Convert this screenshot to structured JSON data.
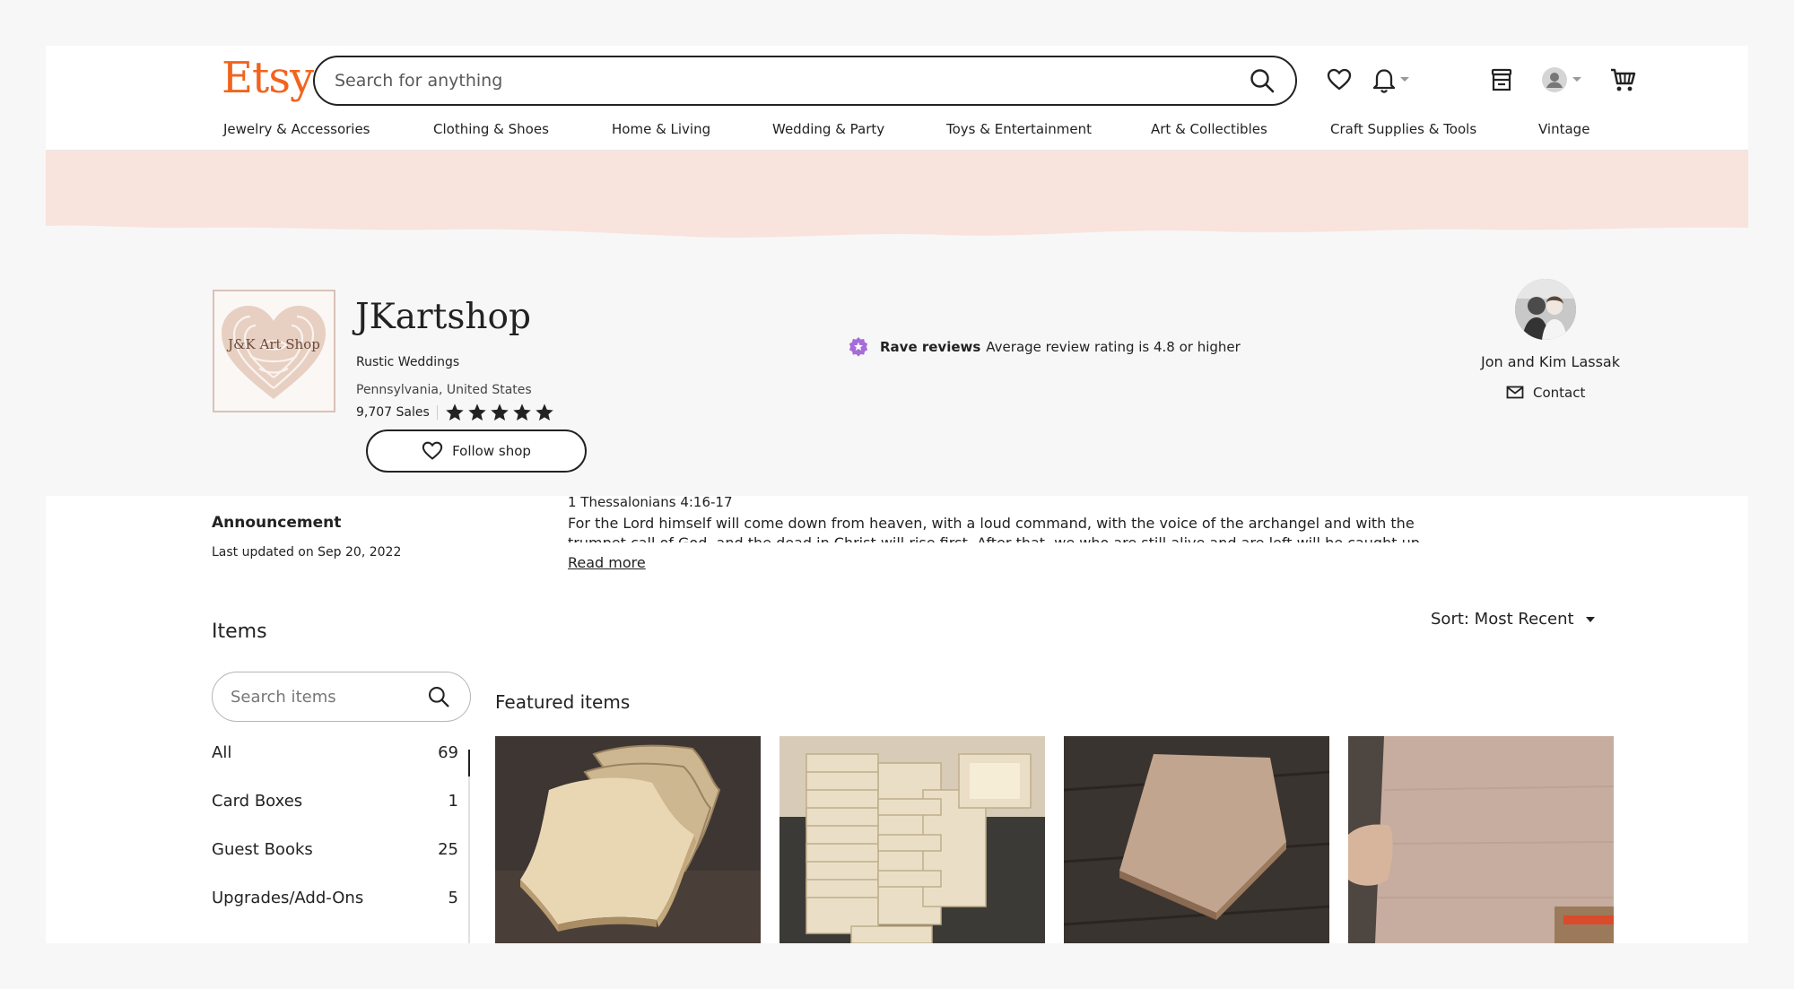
{
  "header": {
    "logo": "Etsy",
    "search_placeholder": "Search for anything",
    "nav": [
      "Jewelry & Accessories",
      "Clothing & Shoes",
      "Home & Living",
      "Wedding & Party",
      "Toys & Entertainment",
      "Art & Collectibles",
      "Craft Supplies & Tools",
      "Vintage"
    ],
    "icons": [
      "heart-icon",
      "bell-icon",
      "shop-icon",
      "account-icon",
      "cart-icon"
    ]
  },
  "shop": {
    "logo_text": "J&K Art Shop",
    "name": "JKartshop",
    "tagline": "Rustic Weddings",
    "location": "Pennsylvania, United States",
    "sales": "9,707 Sales",
    "rating_stars": 5,
    "follow_label": "Follow shop",
    "rave_title": "Rave reviews",
    "rave_desc": "Average review rating is 4.8 or higher",
    "owner": "Jon and Kim Lassak",
    "contact_label": "Contact"
  },
  "announcement": {
    "title": "Announcement",
    "updated": "Last updated on Sep 20, 2022",
    "verse": "1 Thessalonians 4:16-17",
    "text": "For the Lord himself will come down from heaven, with a loud command, with the voice of the archangel and with the trumpet call of God, and the dead in Christ will rise first. After that, we who are still alive and are left will be caught up together with",
    "read_more": "Read more"
  },
  "items": {
    "title": "Items",
    "search_placeholder": "Search items",
    "sort_label": "Sort: Most Recent",
    "featured_title": "Featured items",
    "sections": [
      {
        "label": "All",
        "count": "69"
      },
      {
        "label": "Card Boxes",
        "count": "1"
      },
      {
        "label": "Guest Books",
        "count": "25"
      },
      {
        "label": "Upgrades/Add-Ons",
        "count": "5"
      }
    ]
  },
  "colors": {
    "brand": "#f1641e",
    "banner": "#f9e3dd",
    "rave_badge": "#a66cd8"
  }
}
